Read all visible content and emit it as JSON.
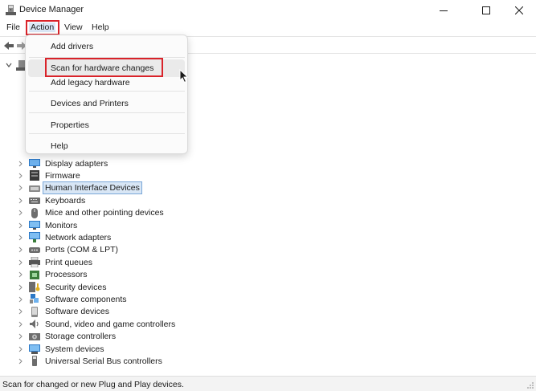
{
  "window": {
    "title": "Device Manager",
    "icon": "device-manager-icon",
    "controls": [
      "minimize-icon",
      "maximize-icon",
      "close-icon"
    ]
  },
  "menubar": {
    "items": [
      {
        "label": "File"
      },
      {
        "label": "Action",
        "state": "open"
      },
      {
        "label": "View"
      },
      {
        "label": "Help"
      }
    ]
  },
  "action_menu": {
    "items": [
      {
        "label": "Add drivers"
      },
      {
        "label": "Scan for hardware changes",
        "state": "hover"
      },
      {
        "label": "Add legacy hardware"
      },
      {
        "label": "Devices and Printers"
      },
      {
        "label": "Properties"
      },
      {
        "label": "Help"
      }
    ]
  },
  "tree": {
    "items": [
      {
        "label": "Display adapters",
        "icon": "display-adapter-icon"
      },
      {
        "label": "Firmware",
        "icon": "firmware-icon"
      },
      {
        "label": "Human Interface Devices",
        "icon": "hid-icon",
        "selected": true
      },
      {
        "label": "Keyboards",
        "icon": "keyboard-icon"
      },
      {
        "label": "Mice and other pointing devices",
        "icon": "mouse-icon"
      },
      {
        "label": "Monitors",
        "icon": "monitor-icon"
      },
      {
        "label": "Network adapters",
        "icon": "network-adapter-icon"
      },
      {
        "label": "Ports (COM & LPT)",
        "icon": "port-icon"
      },
      {
        "label": "Print queues",
        "icon": "printer-icon"
      },
      {
        "label": "Processors",
        "icon": "processor-icon"
      },
      {
        "label": "Security devices",
        "icon": "security-device-icon"
      },
      {
        "label": "Software components",
        "icon": "software-component-icon"
      },
      {
        "label": "Software devices",
        "icon": "software-device-icon"
      },
      {
        "label": "Sound, video and game controllers",
        "icon": "sound-icon"
      },
      {
        "label": "Storage controllers",
        "icon": "storage-controller-icon"
      },
      {
        "label": "System devices",
        "icon": "system-device-icon"
      },
      {
        "label": "Universal Serial Bus controllers",
        "icon": "usb-icon"
      }
    ]
  },
  "statusbar": {
    "text": "Scan for changed or new Plug and Play devices."
  },
  "colors": {
    "annotation": "#d9232a",
    "selection": "#d8e6f5",
    "icon_blue": "#2b78c6"
  }
}
